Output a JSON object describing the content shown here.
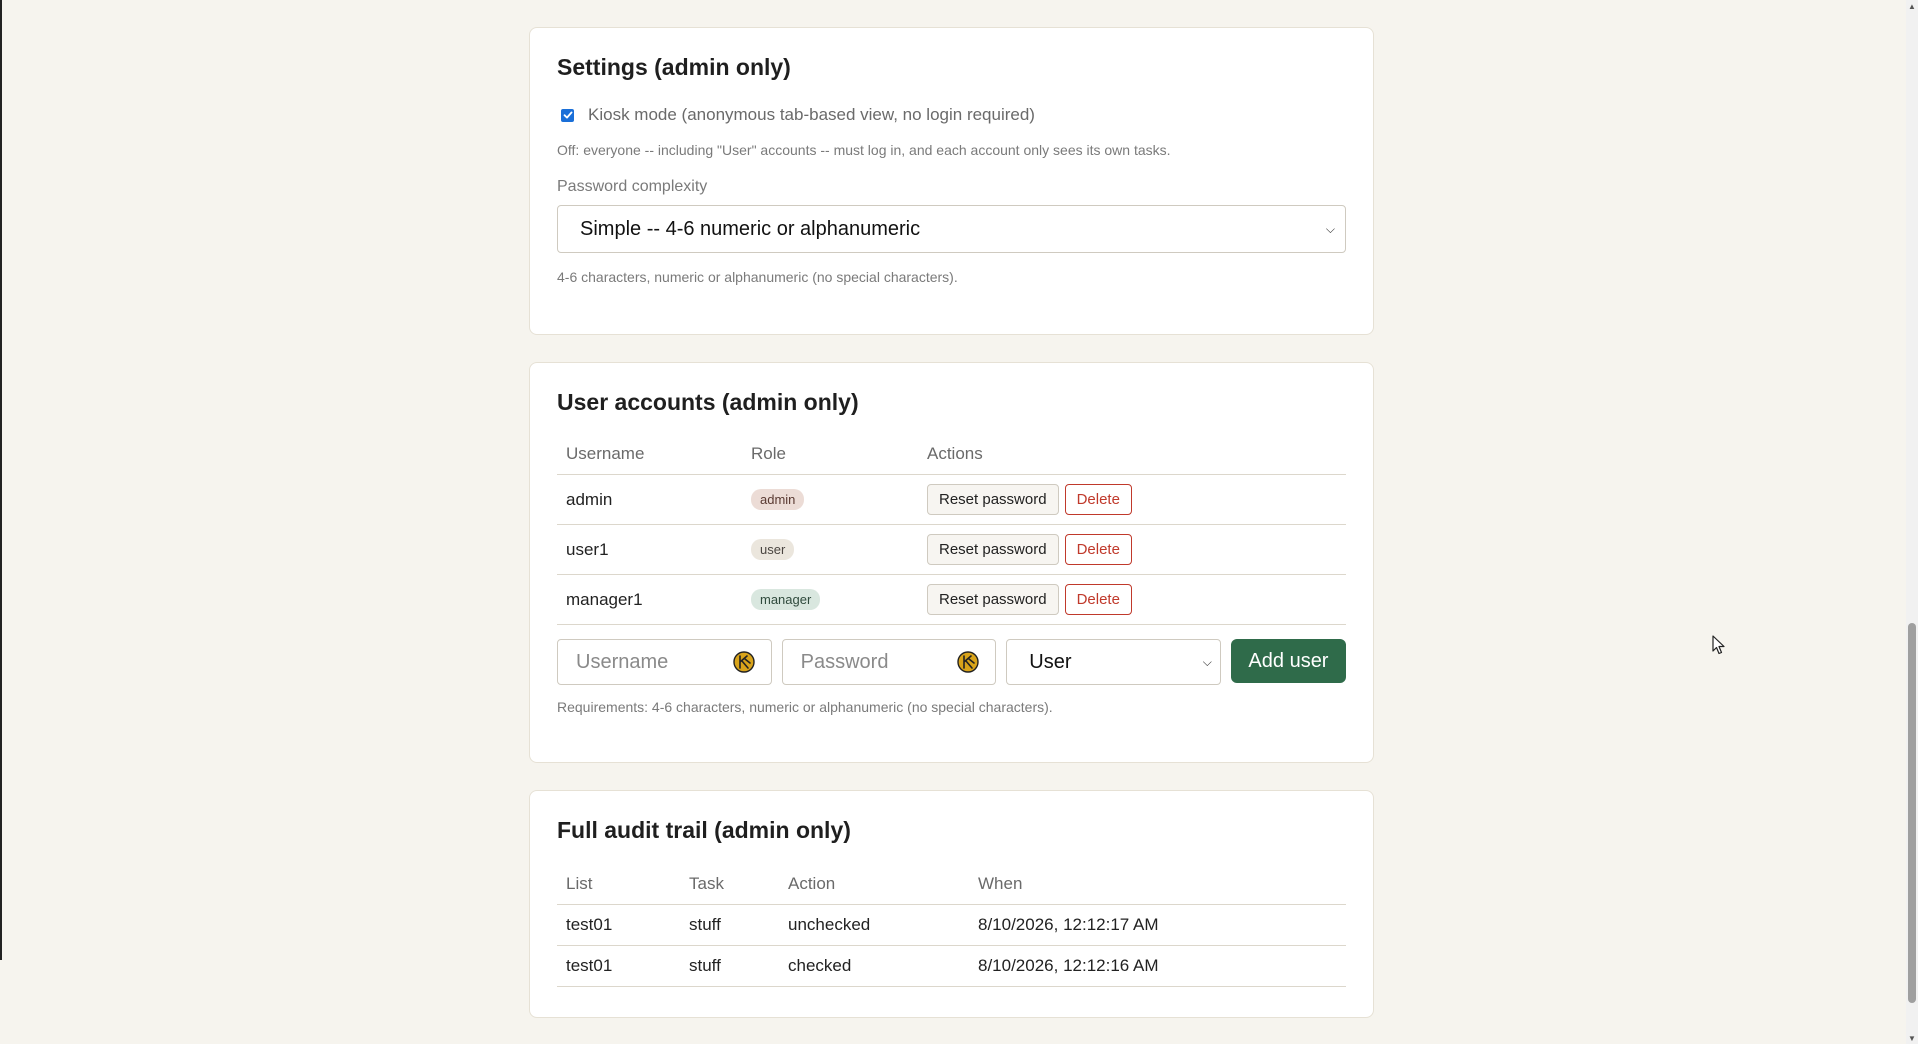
{
  "settings": {
    "title": "Settings (admin only)",
    "kiosk_label": "Kiosk mode (anonymous tab-based view, no login required)",
    "kiosk_checked": true,
    "kiosk_note": "Off: everyone -- including \"User\" accounts -- must log in, and each account only sees its own tasks.",
    "complexity_label": "Password complexity",
    "complexity_value": "Simple -- 4-6 numeric or alphanumeric",
    "complexity_note": "4-6 characters, numeric or alphanumeric (no special characters)."
  },
  "users": {
    "title": "User accounts (admin only)",
    "headers": [
      "Username",
      "Role",
      "Actions"
    ],
    "rows": [
      {
        "username": "admin",
        "role": "admin"
      },
      {
        "username": "user1",
        "role": "user"
      },
      {
        "username": "manager1",
        "role": "manager"
      }
    ],
    "reset_label": "Reset password",
    "delete_label": "Delete",
    "username_placeholder": "Username",
    "password_placeholder": "Password",
    "role_select_value": "User",
    "add_label": "Add user",
    "requirements_note": "Requirements: 4-6 characters, numeric or alphanumeric (no special characters)."
  },
  "audit": {
    "title": "Full audit trail (admin only)",
    "headers": [
      "List",
      "Task",
      "Action",
      "When"
    ],
    "rows": [
      {
        "list": "test01",
        "task": "stuff",
        "action": "unchecked",
        "when": "8/10/2026, 12:12:17 AM"
      },
      {
        "list": "test01",
        "task": "stuff",
        "action": "checked",
        "when": "8/10/2026, 12:12:16 AM"
      }
    ]
  },
  "icons": {
    "password_manager": "key-badge-icon",
    "check": "check-icon",
    "chevron": "chevron-down-icon"
  },
  "colors": {
    "accent_green": "#2f6b4a",
    "delete_red": "#c0392b",
    "checkbox_blue": "#1a6fd8"
  }
}
